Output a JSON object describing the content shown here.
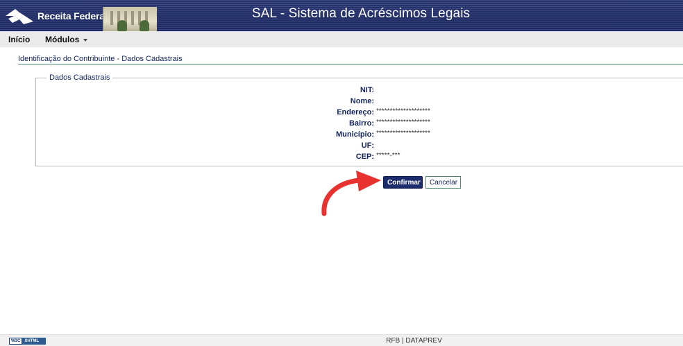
{
  "header": {
    "logo_text": "Receita Federal",
    "app_title": "SAL - Sistema de Acréscimos Legais"
  },
  "menu": {
    "items": [
      {
        "label": "Início",
        "has_dropdown": false
      },
      {
        "label": "Módulos",
        "has_dropdown": true
      }
    ]
  },
  "page": {
    "title": "Identificação do Contribuinte - Dados Cadastrais"
  },
  "section": {
    "legend": "Dados Cadastrais",
    "fields": [
      {
        "label": "NIT:",
        "value": ""
      },
      {
        "label": "Nome:",
        "value": ""
      },
      {
        "label": "Endereço:",
        "value": "********************"
      },
      {
        "label": "Bairro:",
        "value": "********************"
      },
      {
        "label": "Município:",
        "value": "********************"
      },
      {
        "label": "UF:",
        "value": ""
      },
      {
        "label": "CEP:",
        "value": "*****-***"
      }
    ]
  },
  "actions": {
    "confirm_label": "Confirmar",
    "cancel_label": "Cancelar"
  },
  "footer": {
    "text": "RFB | DATAPREV",
    "badge_w3c": "W3C",
    "badge_xhtml": "XHTML"
  },
  "colors": {
    "header_bg": "#1d2a63",
    "label_text": "#13255e",
    "confirm_button": "#1b2b6b",
    "annotation_arrow": "#e8322f"
  },
  "icons": {
    "logo": "receita-federal-logo-icon",
    "menu_caret": "caret-down-icon",
    "annotation": "curved-arrow-icon"
  }
}
